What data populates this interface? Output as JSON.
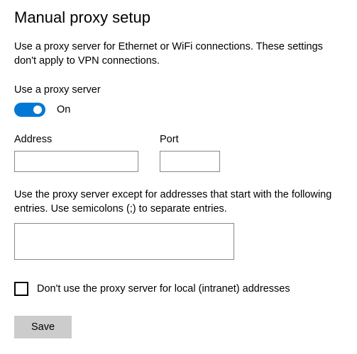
{
  "heading": "Manual proxy setup",
  "description": "Use a proxy server for Ethernet or WiFi connections. These settings don't apply to VPN connections.",
  "toggle": {
    "label": "Use a proxy server",
    "state_label": "On",
    "on": true
  },
  "fields": {
    "address": {
      "label": "Address",
      "value": ""
    },
    "port": {
      "label": "Port",
      "value": ""
    }
  },
  "exceptions": {
    "label": "Use the proxy server except for addresses that start with the following entries. Use semicolons (;) to separate entries.",
    "value": ""
  },
  "checkbox": {
    "label": "Don't use the proxy server for local (intranet) addresses",
    "checked": false
  },
  "save_button_label": "Save",
  "colors": {
    "accent": "#0078d4",
    "button_bg": "#cccccc"
  }
}
